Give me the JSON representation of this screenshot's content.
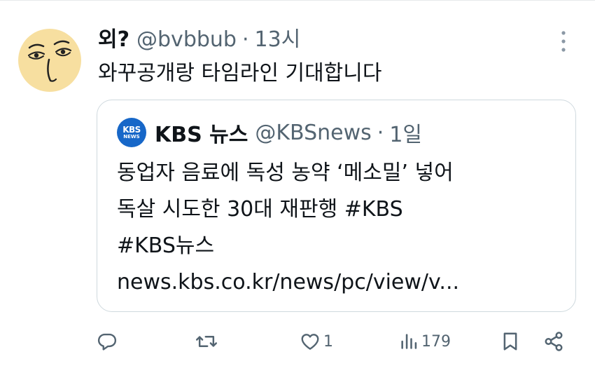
{
  "tweet": {
    "display_name": "외?",
    "handle": "@bvbbub",
    "separator": "·",
    "time": "13시",
    "text": "와꾸공개랑 타임라인 기대합니다"
  },
  "quote": {
    "avatar_line1": "KBS",
    "avatar_line2": "NEWS",
    "display_name": "KBS 뉴스",
    "handle": "@KBSnews",
    "separator": "·",
    "time": "1일",
    "lines": [
      "동업자 음료에 독성 농약 ‘메소밀’ 넣어",
      "독살 시도한 30대 재판행 #KBS",
      "#KBS뉴스",
      "news.kbs.co.kr/news/pc/view/v..."
    ]
  },
  "actions": {
    "reply_icon": "reply-icon",
    "retweet_icon": "retweet-icon",
    "like_icon": "heart-icon",
    "like_count": "1",
    "views_icon": "views-icon",
    "views_count": "179",
    "bookmark_icon": "bookmark-icon",
    "share_icon": "share-icon"
  },
  "colors": {
    "text": "#0f1419",
    "muted": "#536471",
    "border": "#cfd9de",
    "kbs_blue": "#1767c8",
    "avatar_bg": "#f7dfa0"
  }
}
